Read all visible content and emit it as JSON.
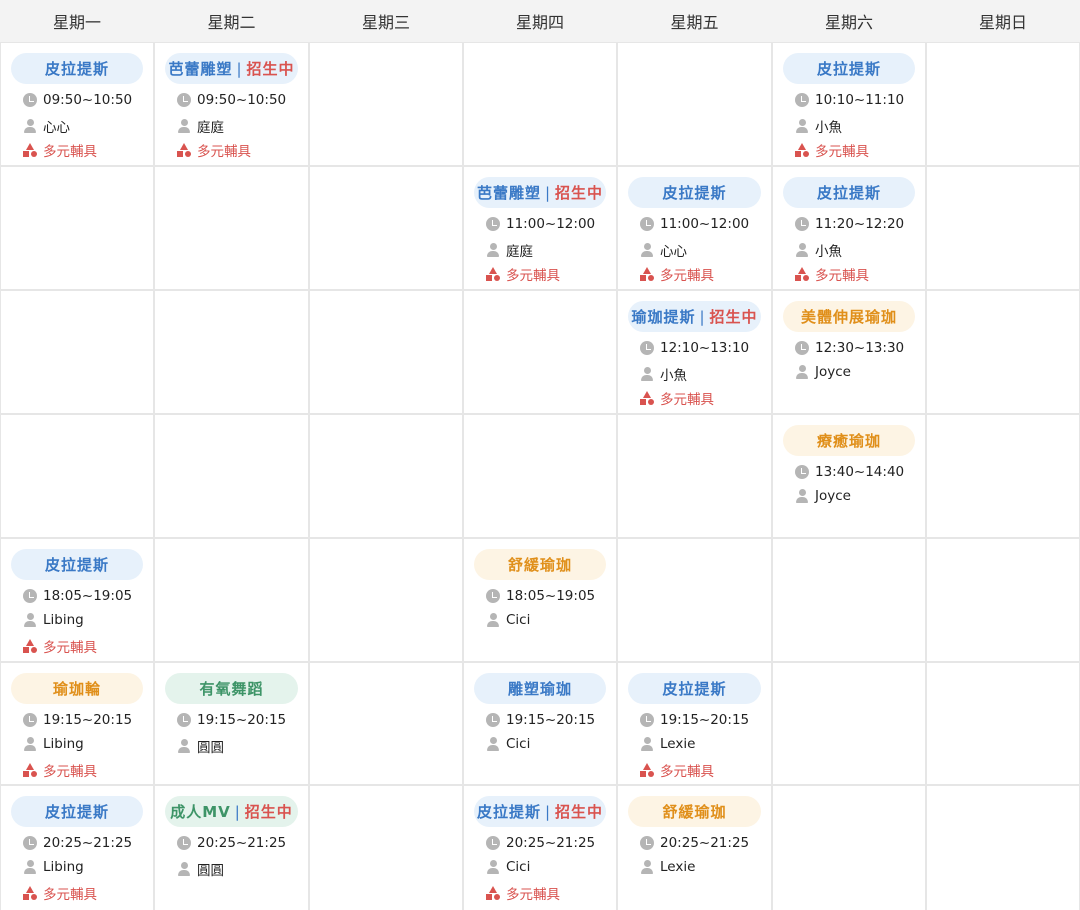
{
  "weekdays": [
    "星期一",
    "星期二",
    "星期三",
    "星期四",
    "星期五",
    "星期六",
    "星期日"
  ],
  "separator": "|",
  "props_label": "多元輔具",
  "colors": {
    "blue": "#3a79c6",
    "orange": "#e08f1a",
    "green": "#3d9467",
    "recruit": "#d9534f"
  },
  "icons": {
    "time": "clock-icon",
    "teacher": "person-icon",
    "props": "shapes-icon"
  },
  "classes": [
    {
      "day": 0,
      "slot": 0,
      "name": "皮拉提斯",
      "recruit": "",
      "color": "blue",
      "time": "09:50~10:50",
      "teacher": "心心",
      "props": true
    },
    {
      "day": 1,
      "slot": 0,
      "name": "芭蕾雕塑",
      "recruit": "招生中",
      "color": "blue",
      "time": "09:50~10:50",
      "teacher": "庭庭",
      "props": true
    },
    {
      "day": 5,
      "slot": 0,
      "name": "皮拉提斯",
      "recruit": "",
      "color": "blue",
      "time": "10:10~11:10",
      "teacher": "小魚",
      "props": true
    },
    {
      "day": 3,
      "slot": 1,
      "name": "芭蕾雕塑",
      "recruit": "招生中",
      "color": "blue",
      "time": "11:00~12:00",
      "teacher": "庭庭",
      "props": true
    },
    {
      "day": 4,
      "slot": 1,
      "name": "皮拉提斯",
      "recruit": "",
      "color": "blue",
      "time": "11:00~12:00",
      "teacher": "心心",
      "props": true
    },
    {
      "day": 5,
      "slot": 1,
      "name": "皮拉提斯",
      "recruit": "",
      "color": "blue",
      "time": "11:20~12:20",
      "teacher": "小魚",
      "props": true
    },
    {
      "day": 4,
      "slot": 2,
      "name": "瑜珈提斯",
      "recruit": "招生中",
      "color": "blue",
      "time": "12:10~13:10",
      "teacher": "小魚",
      "props": true
    },
    {
      "day": 5,
      "slot": 2,
      "name": "美體伸展瑜珈",
      "recruit": "",
      "color": "orange",
      "time": "12:30~13:30",
      "teacher": "Joyce",
      "props": false
    },
    {
      "day": 5,
      "slot": 3,
      "name": "療癒瑜珈",
      "recruit": "",
      "color": "orange",
      "time": "13:40~14:40",
      "teacher": "Joyce",
      "props": false
    },
    {
      "day": 0,
      "slot": 4,
      "name": "皮拉提斯",
      "recruit": "",
      "color": "blue",
      "time": "18:05~19:05",
      "teacher": "Libing",
      "props": true
    },
    {
      "day": 3,
      "slot": 4,
      "name": "舒緩瑜珈",
      "recruit": "",
      "color": "orange",
      "time": "18:05~19:05",
      "teacher": "Cici",
      "props": false
    },
    {
      "day": 0,
      "slot": 5,
      "name": "瑜珈輪",
      "recruit": "",
      "color": "orange",
      "time": "19:15~20:15",
      "teacher": "Libing",
      "props": true
    },
    {
      "day": 1,
      "slot": 5,
      "name": "有氧舞蹈",
      "recruit": "",
      "color": "green",
      "time": "19:15~20:15",
      "teacher": "圓圓",
      "props": false
    },
    {
      "day": 3,
      "slot": 5,
      "name": "雕塑瑜珈",
      "recruit": "",
      "color": "blue",
      "time": "19:15~20:15",
      "teacher": "Cici",
      "props": false
    },
    {
      "day": 4,
      "slot": 5,
      "name": "皮拉提斯",
      "recruit": "",
      "color": "blue",
      "time": "19:15~20:15",
      "teacher": "Lexie",
      "props": true
    },
    {
      "day": 0,
      "slot": 6,
      "name": "皮拉提斯",
      "recruit": "",
      "color": "blue",
      "time": "20:25~21:25",
      "teacher": "Libing",
      "props": true
    },
    {
      "day": 1,
      "slot": 6,
      "name": "成人MV",
      "recruit": "招生中",
      "color": "green",
      "time": "20:25~21:25",
      "teacher": "圓圓",
      "props": false
    },
    {
      "day": 3,
      "slot": 6,
      "name": "皮拉提斯",
      "recruit": "招生中",
      "color": "blue",
      "time": "20:25~21:25",
      "teacher": "Cici",
      "props": true
    },
    {
      "day": 4,
      "slot": 6,
      "name": "舒緩瑜珈",
      "recruit": "",
      "color": "orange",
      "time": "20:25~21:25",
      "teacher": "Lexie",
      "props": false
    }
  ]
}
